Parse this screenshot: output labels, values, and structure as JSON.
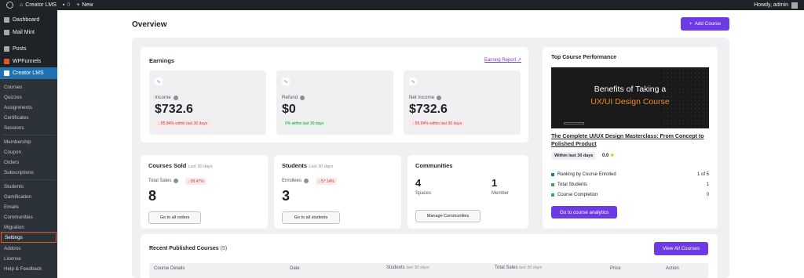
{
  "adminbar": {
    "site_name": "Creator LMS",
    "comments_count": "0",
    "new_label": "New",
    "howdy": "Howdy, admin"
  },
  "sidebar": {
    "top": [
      {
        "label": "Dashboard"
      },
      {
        "label": "Mail Mint"
      },
      {
        "label": "Posts"
      },
      {
        "label": "WPFunnels"
      },
      {
        "label": "Creator LMS"
      }
    ],
    "sub": [
      "Courses",
      "Quizzes",
      "Assignments",
      "Certificates",
      "Sessions",
      "Membership",
      "Coupon",
      "Orders",
      "Subscriptions",
      "Students",
      "Gamification",
      "Emails",
      "Communities",
      "Migration",
      "Settings",
      "Addons",
      "License",
      "Help & Feedback"
    ]
  },
  "page": {
    "title": "Overview",
    "add_course": "Add Course"
  },
  "earnings": {
    "title": "Earnings",
    "report_link": "Earning Report",
    "stats": [
      {
        "label": "Income",
        "value": "$732.6",
        "note": "85.84% within last 30 days",
        "tone": "red"
      },
      {
        "label": "Refund",
        "value": "$0",
        "note": "0% within last 30 days",
        "tone": "green"
      },
      {
        "label": "Net Income",
        "value": "$732.6",
        "note": "85.84% within last 30 days",
        "tone": "red"
      }
    ]
  },
  "courses_sold": {
    "title": "Courses Sold",
    "period": "Last 30 days",
    "label": "Total Sales",
    "delta": "89.47%",
    "value": "8",
    "button": "Go to all orders"
  },
  "students": {
    "title": "Students",
    "period": "Last 30 days",
    "label": "Enrollees",
    "delta": "57.14%",
    "value": "3",
    "button": "Go to all students"
  },
  "communities": {
    "title": "Communities",
    "spaces_value": "4",
    "spaces_label": "Spaces",
    "member_value": "1",
    "member_label": "Member",
    "button": "Manage Communities"
  },
  "top_course": {
    "title": "Top Course Performance",
    "thumb_line1": "Benefits of Taking a",
    "thumb_line2": "UX/UI Design Course",
    "course_name": "The Complete UI/UX Design Masterclass: From Concept to Polished Product",
    "period_badge": "Within last 30 days",
    "rating": "0.0",
    "rows": [
      {
        "label": "Ranking by Course Enrolled",
        "value": "1 of 5",
        "color": "#2271b1"
      },
      {
        "label": "Total Students",
        "value": "1",
        "color": "#46a14b"
      },
      {
        "label": "Course Completion",
        "value": "0",
        "color": "#22a6b3"
      }
    ],
    "button": "Go to course analytics"
  },
  "recent": {
    "title": "Recent Published Courses",
    "count": "(5)",
    "view_all": "View All Courses",
    "columns": {
      "details": "Course Details",
      "date": "Date",
      "students": "Students",
      "students_period": "last 30 days",
      "sales": "Total Sales",
      "sales_period": "last 30 days",
      "price": "Price",
      "action": "Action"
    }
  },
  "colors": {
    "accent": "#6c3be5",
    "admin_dark": "#1d2327",
    "active_menu": "#2271b1",
    "highlight": "#e3582b"
  }
}
